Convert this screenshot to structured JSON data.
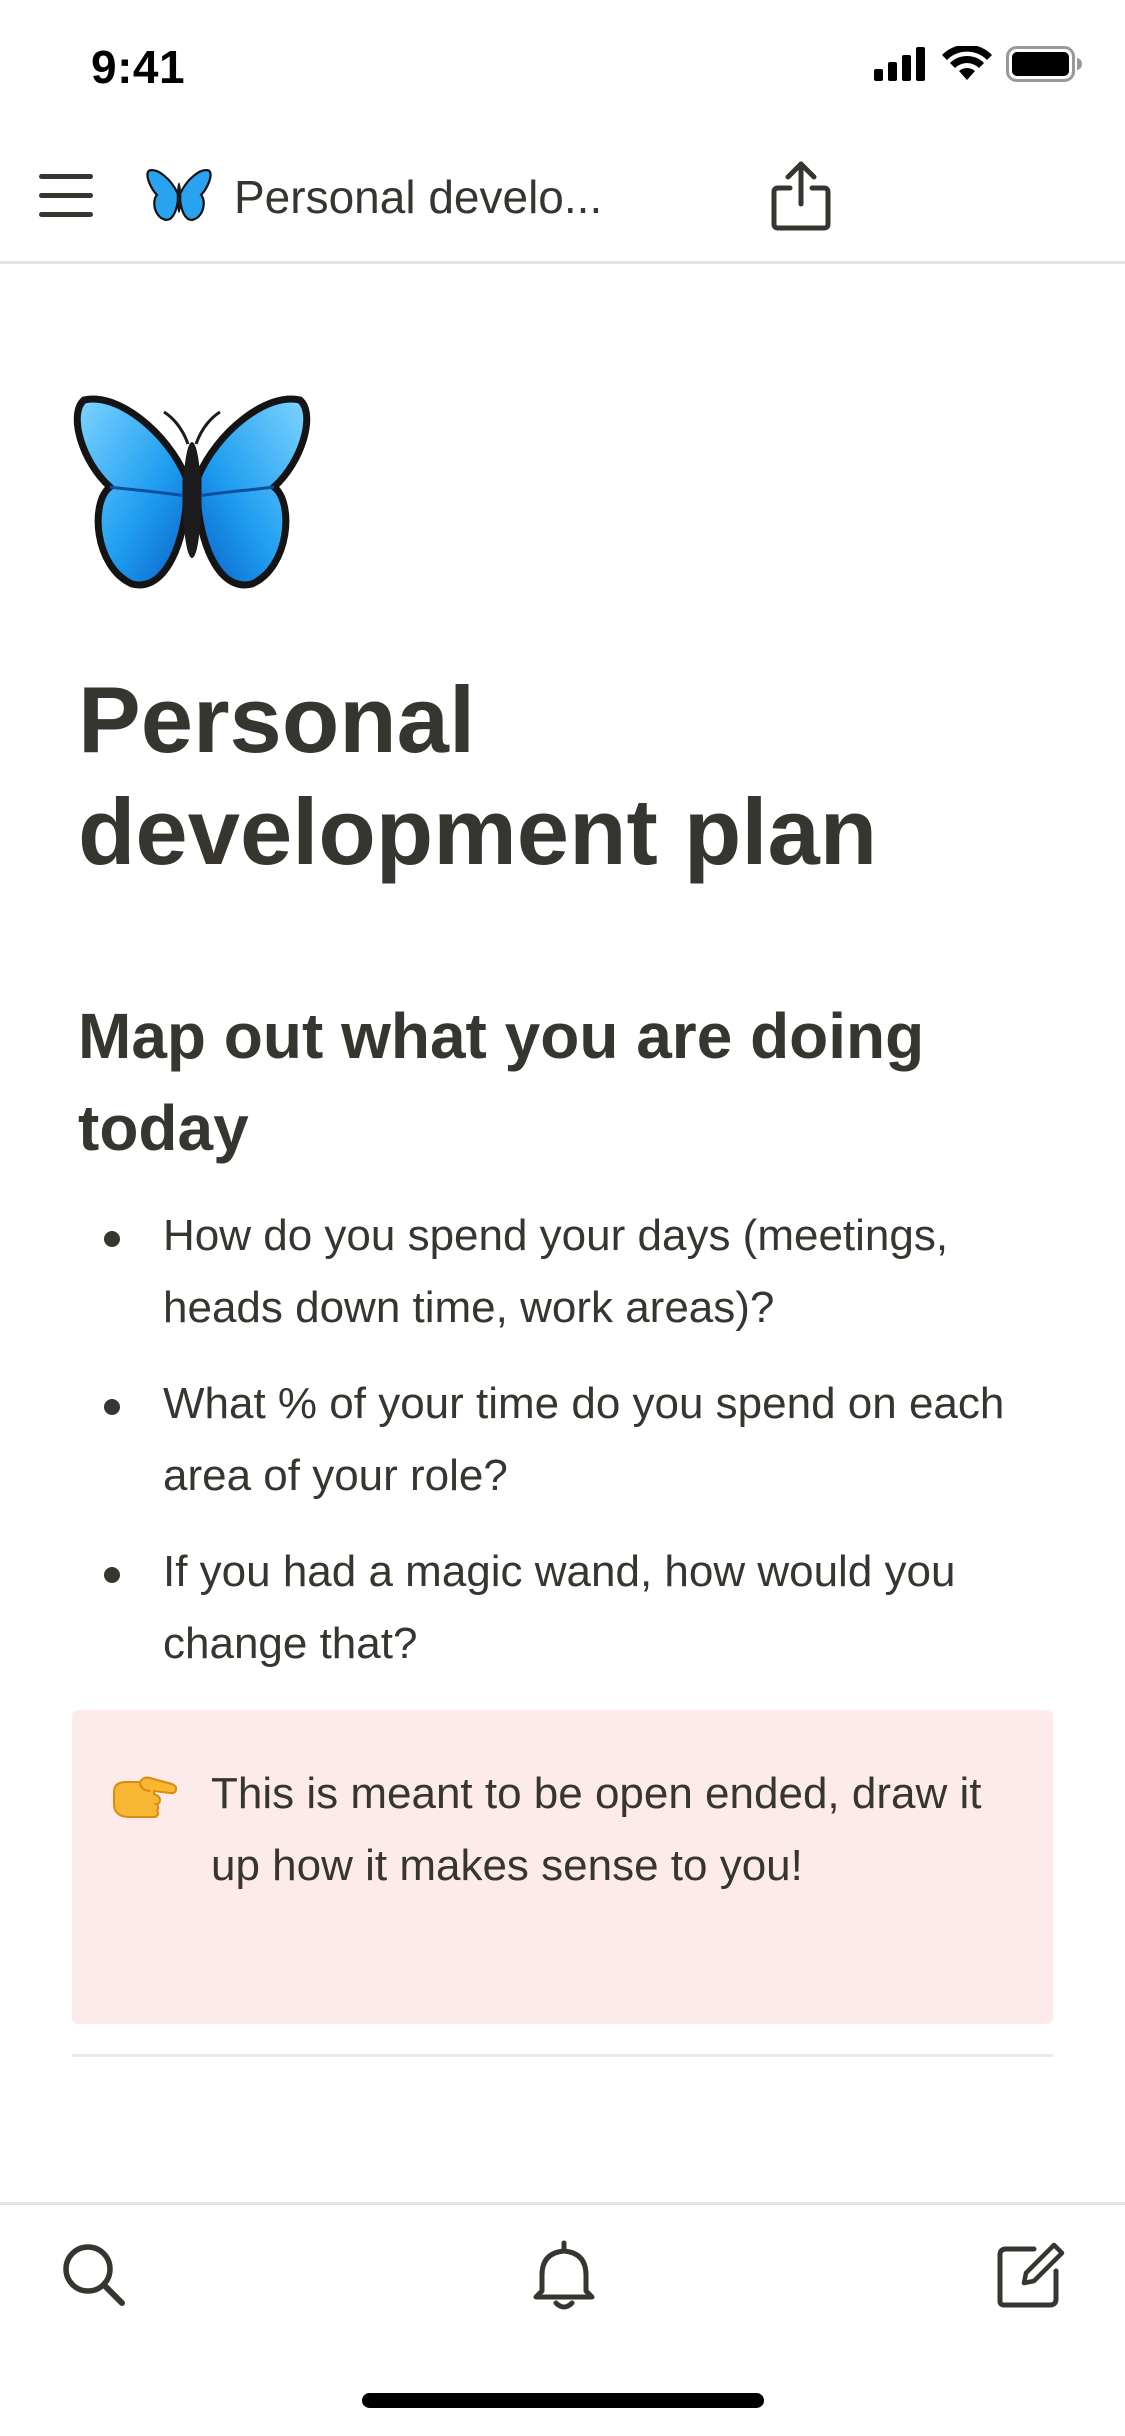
{
  "status_bar": {
    "time": "9:41",
    "icons": [
      "cellular-signal-icon",
      "wifi-icon",
      "battery-icon"
    ]
  },
  "nav": {
    "menu_icon": "hamburger-menu-icon",
    "page_icon": "butterfly-icon",
    "title": "Personal develo...",
    "share_icon": "share-icon"
  },
  "page": {
    "icon": "butterfly-icon",
    "title": "Personal development plan",
    "heading": "Map out what you are doing today",
    "bullets": [
      "How do you spend your days (meetings, heads down time, work areas)?",
      "What % of your time do you spend on each area of your role?",
      "If you had a magic wand, how would you change that?"
    ],
    "callout": {
      "icon": "pointing-right-hand-icon",
      "text": "This is meant to be open ended, draw it up how it makes sense to you!",
      "background_color": "#fdebec"
    }
  },
  "tab_bar": {
    "items": [
      "search-icon",
      "bell-icon",
      "compose-icon"
    ]
  },
  "colors": {
    "text": "#37352f",
    "callout_bg": "#fdebec",
    "divider": "#e3e3e1"
  }
}
